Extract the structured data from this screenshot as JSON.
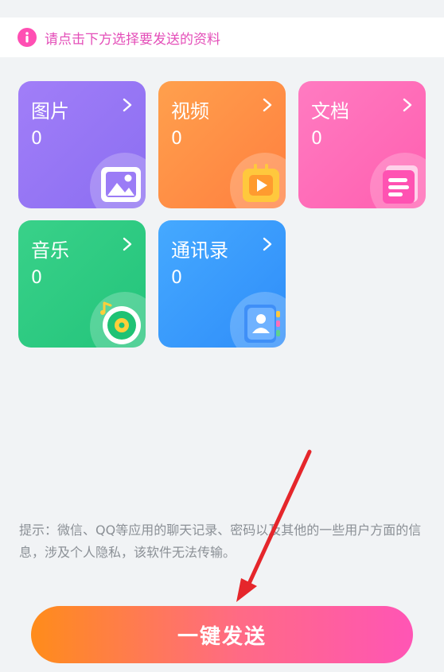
{
  "notice": {
    "text": "请点击下方选择要发送的资料",
    "icon": "info-icon",
    "accent": "#ff4fb3"
  },
  "categories": [
    {
      "label": "图片",
      "count": "0",
      "icon": "image-icon"
    },
    {
      "label": "视频",
      "count": "0",
      "icon": "video-play-icon"
    },
    {
      "label": "文档",
      "count": "0",
      "icon": "document-icon"
    },
    {
      "label": "音乐",
      "count": "0",
      "icon": "music-disc-icon"
    },
    {
      "label": "通讯录",
      "count": "0",
      "icon": "contacts-book-icon"
    }
  ],
  "hint": {
    "text": "提示：微信、QQ等应用的聊天记录、密码以及其他的一些用户方面的信息，涉及个人隐私，该软件无法传输。"
  },
  "send_button": {
    "label": "一键发送"
  },
  "colors": {
    "background": "#f1f3f5",
    "annotation_arrow": "#e5262b"
  }
}
